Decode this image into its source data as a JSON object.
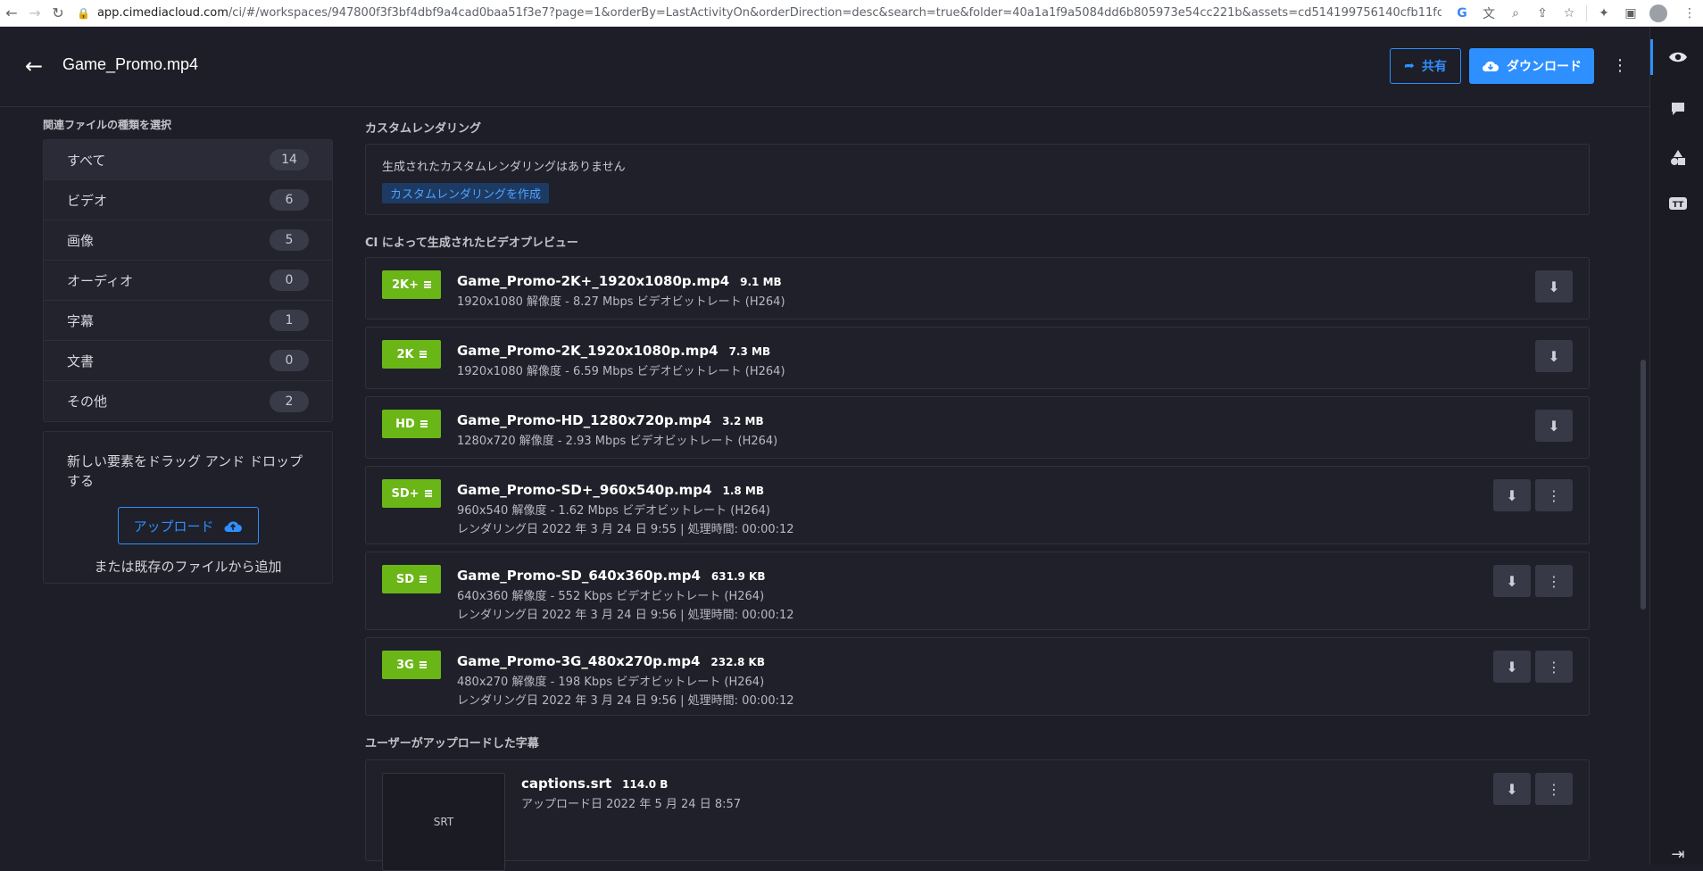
{
  "browser": {
    "host": "app.cimediacloud.com",
    "path": "/ci/#/workspaces/947800f3f3bf4dbf9a4cad0baa51f3e7?page=1&orderBy=LastActivityOn&orderDirection=desc&search=true&folder=40a1a1f9a5084dd6b805973e54cc221b&assets=cd514199756140cfb11fc462653..."
  },
  "header": {
    "title": "Game_Promo.mp4",
    "share_label": "共有",
    "download_label": "ダウンロード"
  },
  "sidebar": {
    "heading": "関連ファイルの種類を選択",
    "types": [
      {
        "label": "すべて",
        "count": "14"
      },
      {
        "label": "ビデオ",
        "count": "6"
      },
      {
        "label": "画像",
        "count": "5"
      },
      {
        "label": "オーディオ",
        "count": "0"
      },
      {
        "label": "字幕",
        "count": "1"
      },
      {
        "label": "文書",
        "count": "0"
      },
      {
        "label": "その他",
        "count": "2"
      }
    ],
    "drop_text": "新しい要素をドラッグ アンド ドロップする",
    "upload_label": "アップロード",
    "or_text": "または既存のファイルから追加"
  },
  "custom": {
    "heading": "カスタムレンダリング",
    "none_text": "生成されたカスタムレンダリングはありません",
    "create_label": "カスタムレンダリングを作成"
  },
  "previews": {
    "heading": "CI によって生成されたビデオプレビュー",
    "items": [
      {
        "badge": "2K+",
        "name": "Game_Promo-2K+_1920x1080p.mp4",
        "size": "9.1 MB",
        "meta": "1920x1080 解像度 - 8.27 Mbps ビデオビットレート (H264)",
        "meta2": ""
      },
      {
        "badge": "2K",
        "name": "Game_Promo-2K_1920x1080p.mp4",
        "size": "7.3 MB",
        "meta": "1920x1080 解像度 - 6.59 Mbps ビデオビットレート (H264)",
        "meta2": ""
      },
      {
        "badge": "HD",
        "name": "Game_Promo-HD_1280x720p.mp4",
        "size": "3.2 MB",
        "meta": "1280x720 解像度 - 2.93 Mbps ビデオビットレート (H264)",
        "meta2": ""
      },
      {
        "badge": "SD+",
        "name": "Game_Promo-SD+_960x540p.mp4",
        "size": "1.8 MB",
        "meta": "960x540 解像度 - 1.62 Mbps ビデオビットレート (H264)",
        "meta2": "レンダリング日 2022 年 3 月 24 日 9:55 | 処理時間: 00:00:12"
      },
      {
        "badge": "SD",
        "name": "Game_Promo-SD_640x360p.mp4",
        "size": "631.9 KB",
        "meta": "640x360 解像度 - 552 Kbps ビデオビットレート (H264)",
        "meta2": "レンダリング日 2022 年 3 月 24 日 9:56 | 処理時間: 00:00:12"
      },
      {
        "badge": "3G",
        "name": "Game_Promo-3G_480x270p.mp4",
        "size": "232.8 KB",
        "meta": "480x270 解像度 - 198 Kbps ビデオビットレート (H264)",
        "meta2": "レンダリング日 2022 年 3 月 24 日 9:56 | 処理時間: 00:00:12"
      }
    ]
  },
  "subtitles": {
    "heading": "ユーザーがアップロードした字幕",
    "items": [
      {
        "thumb": "SRT",
        "name": "captions.srt",
        "size": "114.0 B",
        "meta": "アップロード日 2022 年 5 月 24 日 8:57"
      }
    ]
  },
  "colors": {
    "accent": "#2e8fff",
    "badge_green": "#6ab617",
    "background": "#1d1e27"
  }
}
